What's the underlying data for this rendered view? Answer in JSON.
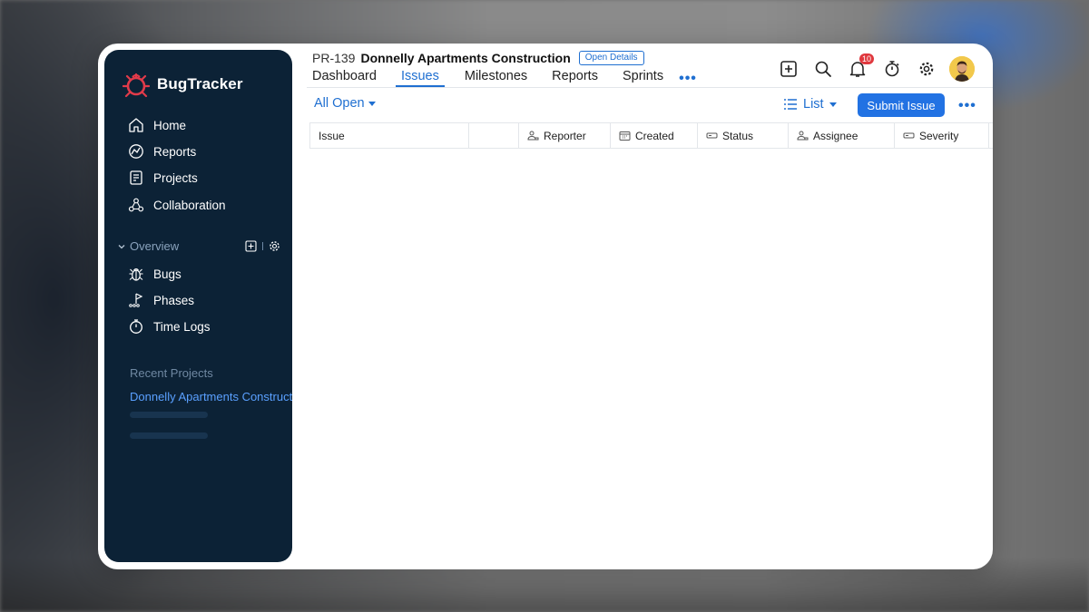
{
  "app": {
    "name": "BugTracker"
  },
  "sidebar": {
    "nav": [
      {
        "label": "Home",
        "icon": "home-icon"
      },
      {
        "label": "Reports",
        "icon": "reports-icon"
      },
      {
        "label": "Projects",
        "icon": "projects-icon"
      },
      {
        "label": "Collaboration",
        "icon": "collaboration-icon"
      }
    ],
    "section": {
      "label": "Overview"
    },
    "section_items": [
      {
        "label": "Bugs",
        "icon": "bug-icon"
      },
      {
        "label": "Phases",
        "icon": "phases-icon"
      },
      {
        "label": "Time Logs",
        "icon": "stopwatch-icon"
      }
    ],
    "recent_label": "Recent Projects",
    "recent_items": [
      "Donnelly Apartments Construction"
    ]
  },
  "header": {
    "project_id": "PR-139",
    "project_title": "Donnelly Apartments Construction",
    "open_details": "Open Details",
    "tabs": [
      "Dashboard",
      "Issues",
      "Milestones",
      "Reports",
      "Sprints"
    ],
    "active_tab": "Issues",
    "more": "•••",
    "notification_count": "10"
  },
  "toolbar": {
    "filter": "All Open",
    "view": "List",
    "submit": "Submit Issue",
    "more": "•••"
  },
  "table": {
    "columns": [
      "Issue",
      "",
      "Reporter",
      "Created",
      "Status",
      "Assignee",
      "Severity"
    ]
  },
  "colors": {
    "sidebar_bg": "#0c2236",
    "accent": "#1f6fd1",
    "button": "#2272e3",
    "badge_red": "#e0383e"
  }
}
